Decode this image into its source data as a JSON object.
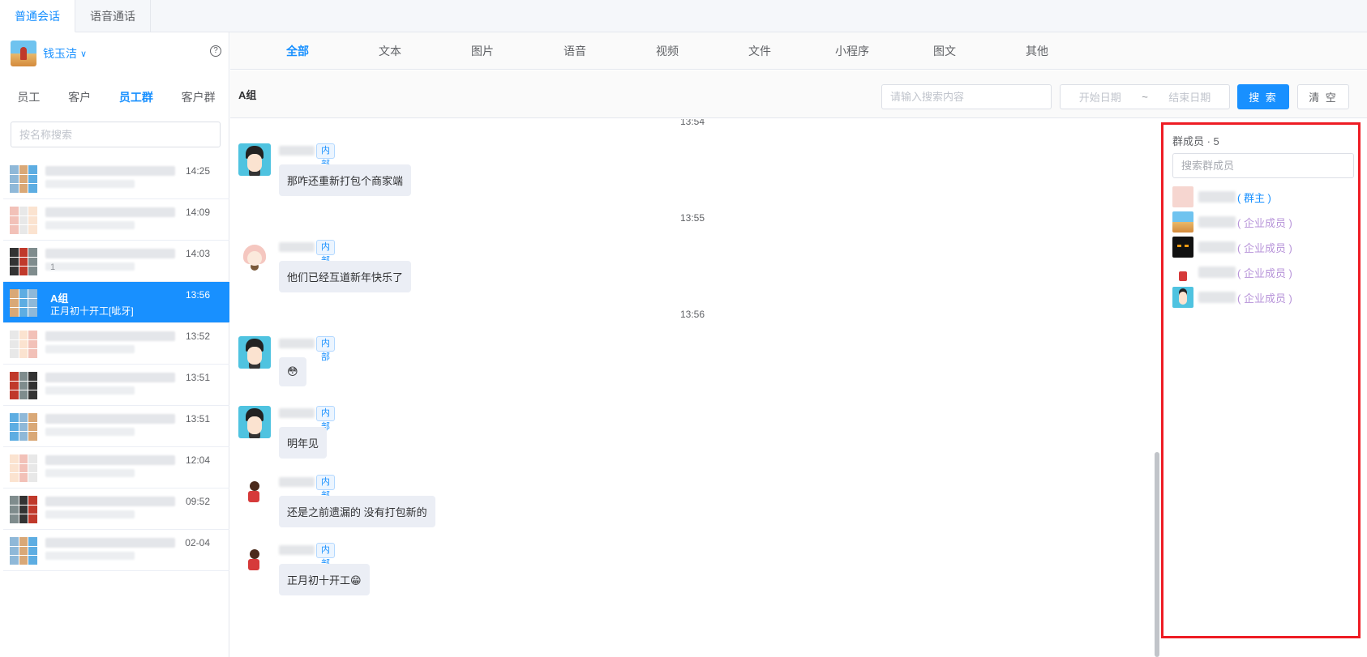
{
  "top_tabs": [
    {
      "label": "普通会话",
      "active": true
    },
    {
      "label": "语音通话",
      "active": false
    }
  ],
  "user": {
    "name": "钱玉洁",
    "caret": "∨",
    "help": "?"
  },
  "sub_tabs": [
    {
      "label": "员工",
      "active": false
    },
    {
      "label": "客户",
      "active": false
    },
    {
      "label": "员工群",
      "active": true
    },
    {
      "label": "客户群",
      "active": false
    }
  ],
  "name_search": {
    "placeholder": "按名称搜索"
  },
  "conversations": [
    {
      "time": "14:25",
      "sub": ""
    },
    {
      "time": "14:09",
      "sub": ""
    },
    {
      "time": "14:03",
      "sub": "1"
    },
    {
      "time": "13:56",
      "title": "A组",
      "preview": "正月初十开工[呲牙]",
      "active": true
    },
    {
      "time": "13:52",
      "sub": ""
    },
    {
      "time": "13:51",
      "sub": ""
    },
    {
      "time": "13:51",
      "sub": ""
    },
    {
      "time": "12:04",
      "sub": ""
    },
    {
      "time": "09:52",
      "sub": ""
    },
    {
      "time": "02-04",
      "sub": ""
    }
  ],
  "filter_tabs": [
    {
      "label": "全部",
      "active": true
    },
    {
      "label": "文本"
    },
    {
      "label": "图片"
    },
    {
      "label": "语音"
    },
    {
      "label": "视频"
    },
    {
      "label": "文件"
    },
    {
      "label": "小程序"
    },
    {
      "label": "图文"
    },
    {
      "label": "其他"
    }
  ],
  "toolbar": {
    "group_title": "A组",
    "search_placeholder": "请输入搜索内容",
    "start_date": "开始日期",
    "range_sep": "~",
    "end_date": "结束日期",
    "search_label": "搜 索",
    "clear_label": "清 空"
  },
  "chat": {
    "time_seps": [
      "13:54",
      "13:55",
      "13:56"
    ],
    "tag_label": "内部",
    "messages": [
      {
        "avatar": "boy",
        "text": "那咋还重新打包个商家端"
      },
      {
        "avatar": "girl",
        "text": "他们已经互道新年快乐了"
      },
      {
        "avatar": "boy",
        "text": "😳"
      },
      {
        "avatar": "boy",
        "text": "明年见"
      },
      {
        "avatar": "red",
        "text": "还是之前遗漏的 没有打包新的"
      },
      {
        "avatar": "red",
        "text": "正月初十开工😁"
      }
    ]
  },
  "members": {
    "title": "群成员 · 5",
    "search_placeholder": "搜索群成员",
    "list": [
      {
        "avatar": "girl",
        "role": "( 群主 )",
        "owner": true
      },
      {
        "avatar": "beach",
        "role": "( 企业成员 )"
      },
      {
        "avatar": "dark",
        "role": "( 企业成员 )"
      },
      {
        "avatar": "red",
        "role": "( 企业成员 )"
      },
      {
        "avatar": "boy",
        "role": "( 企业成员 )"
      }
    ]
  },
  "colors": {
    "accent": "#1890ff",
    "highlight_border": "#ee1c24",
    "member_role": "#b793d9"
  }
}
